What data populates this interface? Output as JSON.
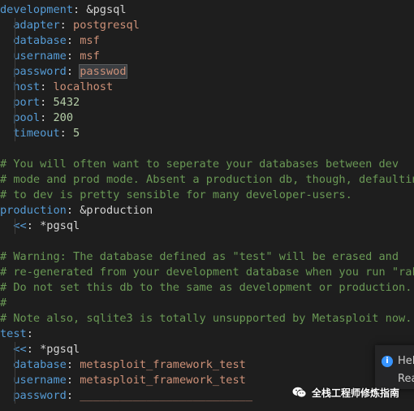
{
  "lines": [
    {
      "indent": false,
      "tokens": [
        {
          "t": "development",
          "c": "key"
        },
        {
          "t": ": ",
          "c": "plain"
        },
        {
          "t": "&pgsql",
          "c": "anchor"
        }
      ]
    },
    {
      "indent": true,
      "tokens": [
        {
          "t": "  ",
          "c": "plain"
        },
        {
          "t": "adapter",
          "c": "key"
        },
        {
          "t": ": ",
          "c": "plain"
        },
        {
          "t": "postgresql",
          "c": "str"
        }
      ]
    },
    {
      "indent": true,
      "tokens": [
        {
          "t": "  ",
          "c": "plain"
        },
        {
          "t": "database",
          "c": "key"
        },
        {
          "t": ": ",
          "c": "plain"
        },
        {
          "t": "msf",
          "c": "str"
        }
      ]
    },
    {
      "indent": true,
      "tokens": [
        {
          "t": "  ",
          "c": "plain"
        },
        {
          "t": "username",
          "c": "key"
        },
        {
          "t": ": ",
          "c": "plain"
        },
        {
          "t": "msf",
          "c": "str"
        }
      ]
    },
    {
      "indent": true,
      "tokens": [
        {
          "t": "  ",
          "c": "plain"
        },
        {
          "t": "password",
          "c": "key"
        },
        {
          "t": ": ",
          "c": "plain"
        },
        {
          "t": "passwod",
          "c": "str sel"
        }
      ]
    },
    {
      "indent": true,
      "tokens": [
        {
          "t": "  ",
          "c": "plain"
        },
        {
          "t": "host",
          "c": "key"
        },
        {
          "t": ": ",
          "c": "plain"
        },
        {
          "t": "localhost",
          "c": "str"
        }
      ]
    },
    {
      "indent": true,
      "tokens": [
        {
          "t": "  ",
          "c": "plain"
        },
        {
          "t": "port",
          "c": "key"
        },
        {
          "t": ": ",
          "c": "plain"
        },
        {
          "t": "5432",
          "c": "num"
        }
      ]
    },
    {
      "indent": true,
      "tokens": [
        {
          "t": "  ",
          "c": "plain"
        },
        {
          "t": "pool",
          "c": "key"
        },
        {
          "t": ": ",
          "c": "plain"
        },
        {
          "t": "200",
          "c": "num"
        }
      ]
    },
    {
      "indent": true,
      "tokens": [
        {
          "t": "  ",
          "c": "plain"
        },
        {
          "t": "timeout",
          "c": "key"
        },
        {
          "t": ": ",
          "c": "plain"
        },
        {
          "t": "5",
          "c": "num"
        }
      ]
    },
    {
      "indent": false,
      "tokens": [
        {
          "t": "",
          "c": "plain"
        }
      ]
    },
    {
      "indent": false,
      "tokens": [
        {
          "t": "# You will often want to seperate your databases between dev",
          "c": "cmt"
        }
      ]
    },
    {
      "indent": false,
      "tokens": [
        {
          "t": "# mode and prod mode. Absent a production db, though, defaulting",
          "c": "cmt"
        }
      ]
    },
    {
      "indent": false,
      "tokens": [
        {
          "t": "# to dev is pretty sensible for many developer-users.",
          "c": "cmt"
        }
      ]
    },
    {
      "indent": false,
      "tokens": [
        {
          "t": "production",
          "c": "key"
        },
        {
          "t": ": ",
          "c": "plain"
        },
        {
          "t": "&production",
          "c": "anchor"
        }
      ]
    },
    {
      "indent": true,
      "tokens": [
        {
          "t": "  ",
          "c": "plain"
        },
        {
          "t": "<<",
          "c": "key"
        },
        {
          "t": ": ",
          "c": "plain"
        },
        {
          "t": "*pgsql",
          "c": "alias"
        }
      ]
    },
    {
      "indent": false,
      "tokens": [
        {
          "t": "",
          "c": "plain"
        }
      ]
    },
    {
      "indent": false,
      "tokens": [
        {
          "t": "# Warning: The database defined as \"test\" will be erased and",
          "c": "cmt"
        }
      ]
    },
    {
      "indent": false,
      "tokens": [
        {
          "t": "# re-generated from your development database when you run \"rake\".",
          "c": "cmt"
        }
      ]
    },
    {
      "indent": false,
      "tokens": [
        {
          "t": "# Do not set this db to the same as development or production.",
          "c": "cmt"
        }
      ]
    },
    {
      "indent": false,
      "tokens": [
        {
          "t": "#",
          "c": "cmt"
        }
      ]
    },
    {
      "indent": false,
      "tokens": [
        {
          "t": "# Note also, sqlite3 is totally unsupported by Metasploit now.",
          "c": "cmt"
        }
      ]
    },
    {
      "indent": false,
      "tokens": [
        {
          "t": "test",
          "c": "key"
        },
        {
          "t": ":",
          "c": "plain"
        }
      ]
    },
    {
      "indent": true,
      "tokens": [
        {
          "t": "  ",
          "c": "plain"
        },
        {
          "t": "<<",
          "c": "key"
        },
        {
          "t": ": ",
          "c": "plain"
        },
        {
          "t": "*pgsql",
          "c": "alias"
        }
      ]
    },
    {
      "indent": true,
      "tokens": [
        {
          "t": "  ",
          "c": "plain"
        },
        {
          "t": "database",
          "c": "key"
        },
        {
          "t": ": ",
          "c": "plain"
        },
        {
          "t": "metasploit_framework_test",
          "c": "str"
        }
      ]
    },
    {
      "indent": true,
      "tokens": [
        {
          "t": "  ",
          "c": "plain"
        },
        {
          "t": "username",
          "c": "key"
        },
        {
          "t": ": ",
          "c": "plain"
        },
        {
          "t": "metasploit_framework_test",
          "c": "str"
        }
      ]
    },
    {
      "indent": true,
      "tokens": [
        {
          "t": "  ",
          "c": "plain"
        },
        {
          "t": "password",
          "c": "key"
        },
        {
          "t": ": ",
          "c": "plain"
        },
        {
          "t": "__________________________",
          "c": "stub"
        }
      ]
    }
  ],
  "notification": {
    "icon": "info-icon",
    "icon_glyph": "i",
    "title": "Hel",
    "body": "Rea"
  },
  "watermark": {
    "text": "全栈工程师修炼指南",
    "icon": "wechat-icon"
  },
  "colors": {
    "background": "#1e1e1e",
    "key": "#569cd6",
    "string": "#ce9178",
    "number": "#b5cea8",
    "comment": "#6a9955",
    "notification_bg": "#252526",
    "info_accent": "#3794ff"
  }
}
